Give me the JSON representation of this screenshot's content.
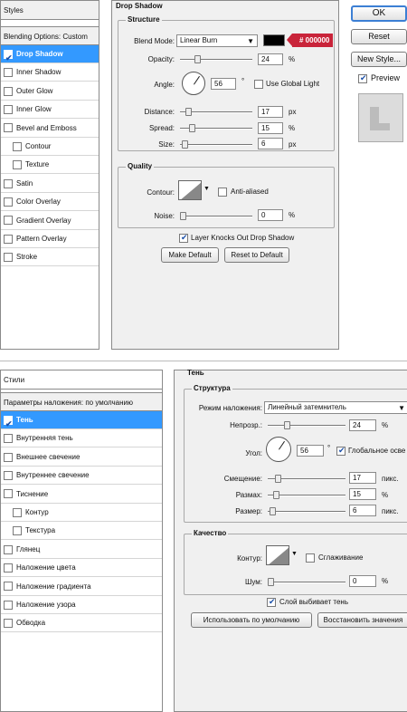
{
  "en": {
    "styles_header": "Styles",
    "blending_options": "Blending Options: Custom",
    "style_items": [
      {
        "label": "Drop Shadow",
        "checked": true,
        "selected": true
      },
      {
        "label": "Inner Shadow",
        "checked": false
      },
      {
        "label": "Outer Glow",
        "checked": false
      },
      {
        "label": "Inner Glow",
        "checked": false
      },
      {
        "label": "Bevel and Emboss",
        "checked": false
      },
      {
        "label": "Contour",
        "checked": false,
        "sub": true
      },
      {
        "label": "Texture",
        "checked": false,
        "sub": true
      },
      {
        "label": "Satin",
        "checked": false
      },
      {
        "label": "Color Overlay",
        "checked": false
      },
      {
        "label": "Gradient Overlay",
        "checked": false
      },
      {
        "label": "Pattern Overlay",
        "checked": false
      },
      {
        "label": "Stroke",
        "checked": false
      }
    ],
    "drop_shadow_title": "Drop Shadow",
    "structure_title": "Structure",
    "blend_mode_label": "Blend Mode:",
    "blend_mode_value": "Linear Burn",
    "color_tag": "# 000000",
    "shadow_color": "#000000",
    "opacity_label": "Opacity:",
    "opacity_value": "24",
    "angle_label": "Angle:",
    "angle_value": "56",
    "degree_symbol": "°",
    "use_global_light": "Use Global Light",
    "distance_label": "Distance:",
    "distance_value": "17",
    "spread_label": "Spread:",
    "spread_value": "15",
    "size_label": "Size:",
    "size_value": "6",
    "unit_px": "px",
    "unit_pct": "%",
    "quality_title": "Quality",
    "contour_label": "Contour:",
    "anti_aliased": "Anti-aliased",
    "noise_label": "Noise:",
    "noise_value": "0",
    "layer_knocks_out": "Layer Knocks Out Drop Shadow",
    "make_default": "Make Default",
    "reset_to_default": "Reset to Default",
    "ok": "OK",
    "reset": "Reset",
    "new_style": "New Style...",
    "preview": "Preview"
  },
  "ru": {
    "styles_header": "Стили",
    "blending_options": "Параметры наложения: по умолчанию",
    "style_items": [
      {
        "label": "Тень",
        "checked": true,
        "selected": true
      },
      {
        "label": "Внутренняя тень",
        "checked": false
      },
      {
        "label": "Внешнее свечение",
        "checked": false
      },
      {
        "label": "Внутреннее свечение",
        "checked": false
      },
      {
        "label": "Тиснение",
        "checked": false
      },
      {
        "label": "Контур",
        "checked": false,
        "sub": true
      },
      {
        "label": "Текстура",
        "checked": false,
        "sub": true
      },
      {
        "label": "Глянец",
        "checked": false
      },
      {
        "label": "Наложение цвета",
        "checked": false
      },
      {
        "label": "Наложение градиента",
        "checked": false
      },
      {
        "label": "Наложение узора",
        "checked": false
      },
      {
        "label": "Обводка",
        "checked": false
      }
    ],
    "drop_shadow_title": "Тень",
    "structure_title": "Структура",
    "blend_mode_label": "Режим наложения:",
    "blend_mode_value": "Линейный затемнитель",
    "opacity_label": "Непрозр.:",
    "opacity_value": "24",
    "angle_label": "Угол:",
    "angle_value": "56",
    "degree_symbol": "°",
    "use_global_light": "Глобальное осве",
    "distance_label": "Смещение:",
    "distance_value": "17",
    "spread_label": "Размах:",
    "spread_value": "15",
    "size_label": "Размер:",
    "size_value": "6",
    "unit_px": "пикс.",
    "unit_pct": "%",
    "quality_title": "Качество",
    "contour_label": "Контур:",
    "anti_aliased": "Сглаживание",
    "noise_label": "Шум:",
    "noise_value": "0",
    "layer_knocks_out": "Слой выбивает тень",
    "make_default": "Использовать по умолчанию",
    "reset_to_default": "Восстановить значения"
  },
  "colors": {
    "selection": "#3399ff",
    "panel_bg": "#f0f0f0",
    "tag": "#c9243a"
  }
}
